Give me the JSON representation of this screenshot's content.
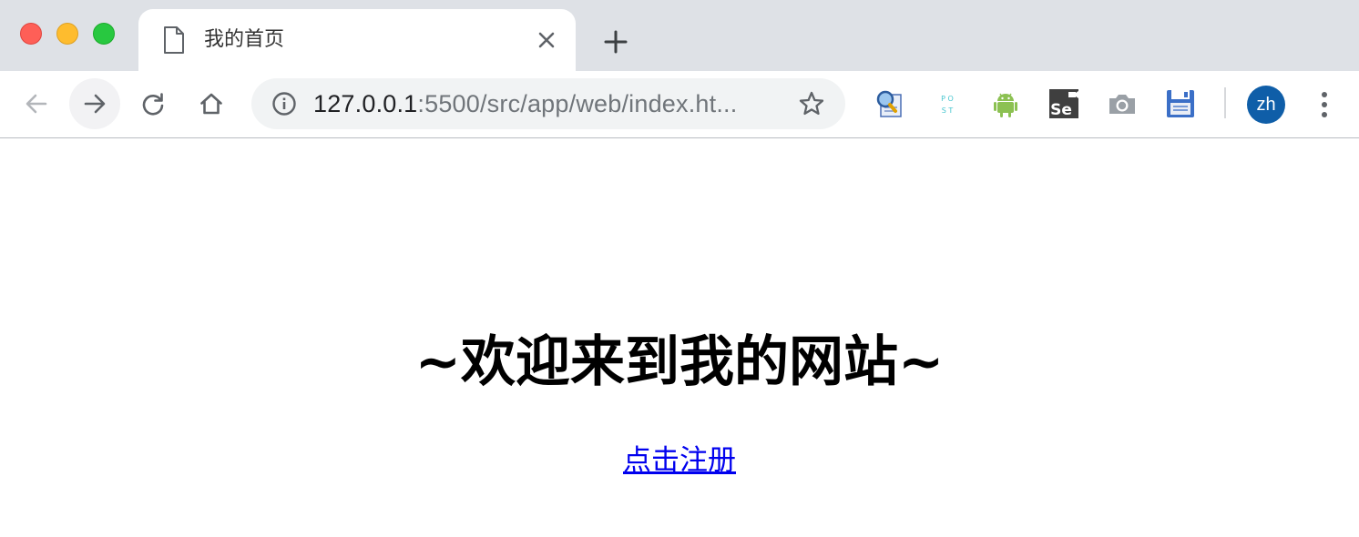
{
  "tab": {
    "title": "我的首页",
    "icon": "document-icon"
  },
  "toolbar": {
    "url_host": "127.0.0.1",
    "url_rest": ":5500/src/app/web/index.ht..."
  },
  "extensions": [
    {
      "name": "search-doc-extension-icon"
    },
    {
      "name": "postman-extension-icon",
      "label_top": "P O",
      "label_bottom": "S T"
    },
    {
      "name": "android-extension-icon"
    },
    {
      "name": "selenium-extension-icon",
      "label": "Se"
    },
    {
      "name": "camera-extension-icon"
    },
    {
      "name": "save-extension-icon"
    }
  ],
  "profile": {
    "initials": "zh",
    "color": "#0f5ea8"
  },
  "page": {
    "heading": "~欢迎来到我的网站~",
    "link_text": "点击注册",
    "link_color": "#0000ee"
  }
}
